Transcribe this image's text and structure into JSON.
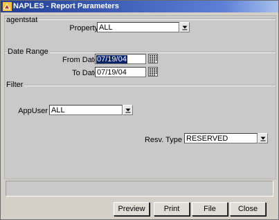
{
  "window": {
    "title": "NAPLES - Report Parameters"
  },
  "sections": {
    "agentstat": "agentstat",
    "date_range": "Date Range",
    "filter": "Filter"
  },
  "fields": {
    "property": {
      "label": "Property",
      "value": "ALL"
    },
    "from_date": {
      "label": "From Date",
      "value": "07/19/04"
    },
    "to_date": {
      "label": "To Date",
      "value": "07/19/04"
    },
    "app_user": {
      "label": "AppUser",
      "value": "ALL"
    },
    "resv_type": {
      "label": "Resv. Type",
      "value": "RESERVED"
    }
  },
  "buttons": {
    "preview": "Preview",
    "print": "Print",
    "file": "File",
    "close": "Close"
  },
  "icons": {
    "app": "window-app-icon",
    "dropdown": "chevron-down-icon",
    "calendar": "calendar-icon"
  },
  "colors": {
    "titlebar": "#1f3e97",
    "selection": "#0a246a",
    "panel": "#c9c9c9"
  }
}
